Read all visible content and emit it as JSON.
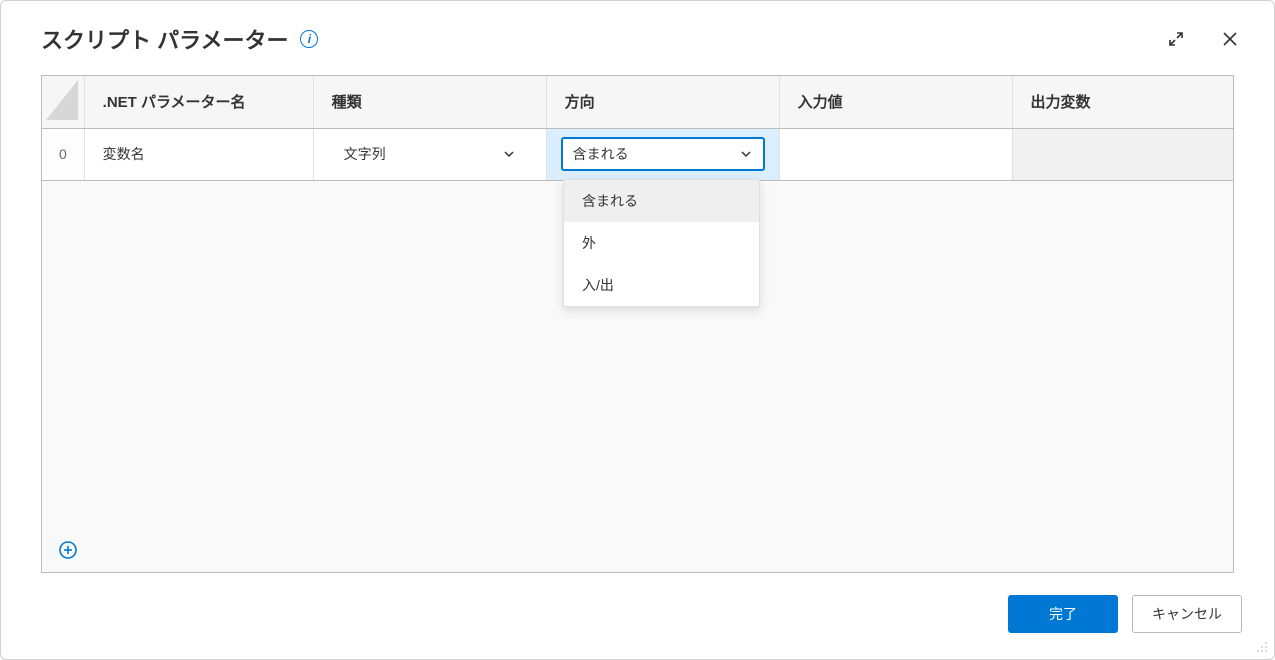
{
  "dialog": {
    "title": "スクリプト パラメーター"
  },
  "table": {
    "headers": {
      "name": ".NET パラメーター名",
      "type": "種類",
      "direction": "方向",
      "input_value": "入力値",
      "output_var": "出力変数"
    },
    "rows": [
      {
        "index": "0",
        "name": "変数名",
        "type": "文字列",
        "direction": "含まれる",
        "input_value": "",
        "output_var": ""
      }
    ]
  },
  "dropdown": {
    "options": [
      "含まれる",
      "外",
      "入/出"
    ],
    "selected": "含まれる"
  },
  "footer": {
    "primary": "完了",
    "secondary": "キャンセル"
  }
}
